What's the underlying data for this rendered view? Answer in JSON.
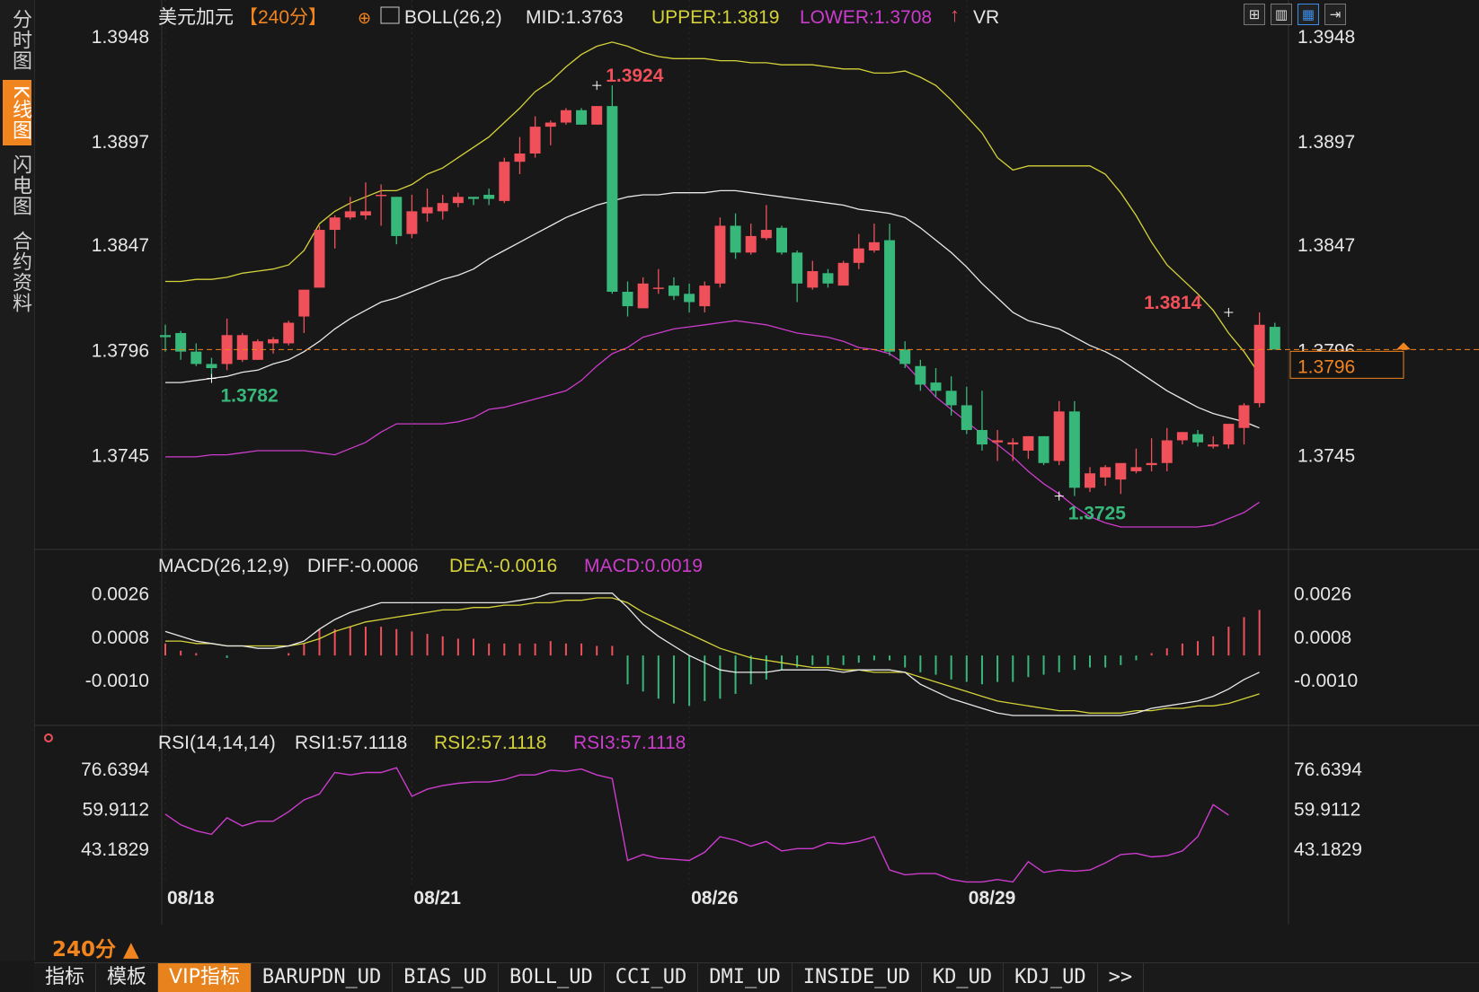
{
  "sidebar": {
    "tabs": [
      {
        "label": "分时图",
        "active": false
      },
      {
        "label": "K线图",
        "active": true
      },
      {
        "label": "闪电图",
        "active": false
      },
      {
        "label": "合约资料",
        "active": false
      }
    ]
  },
  "toolbar_icons": [
    "grid-icon",
    "bar-chart-icon",
    "candle-toggle-icon",
    "expand-icon"
  ],
  "period_label": "240分 ▲",
  "bottom_tabs": [
    {
      "label": "指标",
      "kind": "cn"
    },
    {
      "label": "模板",
      "kind": "cn"
    },
    {
      "label": "VIP指标",
      "kind": "vip"
    },
    {
      "label": "BARUPDN_UD",
      "kind": "mono"
    },
    {
      "label": "BIAS_UD",
      "kind": "mono"
    },
    {
      "label": "BOLL_UD",
      "kind": "mono"
    },
    {
      "label": "CCI_UD",
      "kind": "mono"
    },
    {
      "label": "DMI_UD",
      "kind": "mono"
    },
    {
      "label": "INSIDE_UD",
      "kind": "mono"
    },
    {
      "label": "KD_UD",
      "kind": "mono"
    },
    {
      "label": "KDJ_UD",
      "kind": "mono"
    },
    {
      "label": ">>",
      "kind": "mono"
    }
  ],
  "colors": {
    "up": "#f0505a",
    "down": "#38b77a",
    "mid": "#e8e8e8",
    "upper": "#d4d23a",
    "lower": "#cc3ccc",
    "dea": "#d4d23a",
    "macd": "#cc3ccc",
    "rsi": "#cc3ccc",
    "accent": "#f0841e",
    "grid": "#2a2a2a"
  },
  "chart_data": [
    {
      "type": "candlestick",
      "header": {
        "symbol": "美元加元",
        "period": "【240分】",
        "indicator": "BOLL(26,2)",
        "mid": "MID:1.3763",
        "upper": "UPPER:1.3819",
        "lower": "LOWER:1.3708",
        "extra": "VR"
      },
      "y_ticks": [
        "1.3948",
        "1.3897",
        "1.3847",
        "1.3796",
        "1.3745"
      ],
      "ylim": [
        1.37,
        1.3948
      ],
      "x_ticks": [
        "08/18",
        "08/21",
        "08/26",
        "08/29"
      ],
      "x_tick_index": [
        0,
        16,
        34,
        52
      ],
      "current_price": "1.3796",
      "annotations": [
        {
          "text": "1.3782",
          "index": 3,
          "value": 1.3782,
          "kind": "low"
        },
        {
          "text": "1.3924",
          "index": 28,
          "value": 1.3924,
          "kind": "high"
        },
        {
          "text": "1.3725",
          "index": 58,
          "value": 1.3725,
          "kind": "low"
        },
        {
          "text": "1.3814",
          "index": 69,
          "value": 1.3814,
          "kind": "high"
        }
      ],
      "ohlc": [
        [
          1.3803,
          1.3808,
          1.3795,
          1.3802
        ],
        [
          1.3804,
          1.3805,
          1.3791,
          1.3795
        ],
        [
          1.3795,
          1.3799,
          1.3788,
          1.3789
        ],
        [
          1.3789,
          1.3792,
          1.3782,
          1.3787
        ],
        [
          1.3789,
          1.3811,
          1.3786,
          1.3803
        ],
        [
          1.3791,
          1.3804,
          1.379,
          1.3803
        ],
        [
          1.3791,
          1.3801,
          1.3791,
          1.38
        ],
        [
          1.3799,
          1.3802,
          1.3794,
          1.3801
        ],
        [
          1.3799,
          1.381,
          1.3798,
          1.3809
        ],
        [
          1.3812,
          1.3821,
          1.3804,
          1.3825
        ],
        [
          1.3826,
          1.3856,
          1.3826,
          1.3854
        ],
        [
          1.3854,
          1.3861,
          1.3845,
          1.386
        ],
        [
          1.386,
          1.387,
          1.3859,
          1.3863
        ],
        [
          1.3861,
          1.3877,
          1.3859,
          1.3863
        ],
        [
          1.3871,
          1.3876,
          1.3856,
          1.3871
        ],
        [
          1.387,
          1.387,
          1.3847,
          1.3851
        ],
        [
          1.3852,
          1.3871,
          1.385,
          1.3863
        ],
        [
          1.3862,
          1.3874,
          1.3858,
          1.3865
        ],
        [
          1.3863,
          1.3871,
          1.3859,
          1.3867
        ],
        [
          1.3867,
          1.3872,
          1.3865,
          1.387
        ],
        [
          1.387,
          1.387,
          1.3866,
          1.3869
        ],
        [
          1.3871,
          1.3874,
          1.3866,
          1.3869
        ],
        [
          1.3868,
          1.3889,
          1.3867,
          1.3887
        ],
        [
          1.3887,
          1.3899,
          1.3881,
          1.3891
        ],
        [
          1.3891,
          1.3909,
          1.3889,
          1.3904
        ],
        [
          1.3904,
          1.3907,
          1.3895,
          1.3906
        ],
        [
          1.3906,
          1.3913,
          1.3905,
          1.3912
        ],
        [
          1.3912,
          1.3913,
          1.3905,
          1.3905
        ],
        [
          1.3905,
          1.3914,
          1.3905,
          1.3914
        ],
        [
          1.3914,
          1.3924,
          1.3823,
          1.3824
        ],
        [
          1.3824,
          1.3829,
          1.3812,
          1.3817
        ],
        [
          1.3816,
          1.3831,
          1.3816,
          1.3828
        ],
        [
          1.3826,
          1.3835,
          1.3823,
          1.3826
        ],
        [
          1.3827,
          1.3831,
          1.382,
          1.3822
        ],
        [
          1.3823,
          1.3828,
          1.3814,
          1.3819
        ],
        [
          1.3817,
          1.3829,
          1.3814,
          1.3827
        ],
        [
          1.3828,
          1.386,
          1.3826,
          1.3856
        ],
        [
          1.3856,
          1.3862,
          1.384,
          1.3843
        ],
        [
          1.3843,
          1.3857,
          1.3842,
          1.3851
        ],
        [
          1.385,
          1.3866,
          1.3849,
          1.3854
        ],
        [
          1.3855,
          1.3856,
          1.3842,
          1.3843
        ],
        [
          1.3843,
          1.3844,
          1.3819,
          1.3828
        ],
        [
          1.3826,
          1.3839,
          1.3825,
          1.3834
        ],
        [
          1.3833,
          1.3835,
          1.3826,
          1.3828
        ],
        [
          1.3827,
          1.3839,
          1.3827,
          1.3838
        ],
        [
          1.3838,
          1.3852,
          1.3835,
          1.3845
        ],
        [
          1.3844,
          1.3857,
          1.3843,
          1.3848
        ],
        [
          1.3849,
          1.3857,
          1.3793,
          1.3795
        ],
        [
          1.3796,
          1.38,
          1.3787,
          1.3789
        ],
        [
          1.3788,
          1.3791,
          1.3776,
          1.3779
        ],
        [
          1.378,
          1.3787,
          1.3773,
          1.3776
        ],
        [
          1.3776,
          1.3783,
          1.3764,
          1.3769
        ],
        [
          1.3769,
          1.3778,
          1.3755,
          1.3757
        ],
        [
          1.3757,
          1.3776,
          1.3747,
          1.375
        ],
        [
          1.3751,
          1.3757,
          1.3742,
          1.3752
        ],
        [
          1.375,
          1.3753,
          1.3742,
          1.3751
        ],
        [
          1.3747,
          1.3754,
          1.3743,
          1.3754
        ],
        [
          1.3754,
          1.3754,
          1.374,
          1.3741
        ],
        [
          1.3742,
          1.3771,
          1.374,
          1.3766
        ],
        [
          1.3766,
          1.3771,
          1.3725,
          1.3729
        ],
        [
          1.3729,
          1.3739,
          1.3727,
          1.3736
        ],
        [
          1.3734,
          1.374,
          1.373,
          1.3739
        ],
        [
          1.3733,
          1.3738,
          1.3726,
          1.3741
        ],
        [
          1.3737,
          1.3748,
          1.3736,
          1.3739
        ],
        [
          1.374,
          1.3753,
          1.3737,
          1.3741
        ],
        [
          1.3741,
          1.3758,
          1.3737,
          1.3752
        ],
        [
          1.3752,
          1.3756,
          1.375,
          1.3756
        ],
        [
          1.3755,
          1.3757,
          1.3749,
          1.3751
        ],
        [
          1.3749,
          1.3754,
          1.3748,
          1.375
        ],
        [
          1.375,
          1.3753,
          1.3748,
          1.376
        ],
        [
          1.3758,
          1.377,
          1.375,
          1.3769
        ],
        [
          1.377,
          1.3814,
          1.3768,
          1.3808
        ],
        [
          1.3807,
          1.3809,
          1.3796,
          1.3796
        ]
      ],
      "bands": {
        "upper": [
          1.3829,
          1.3829,
          1.383,
          1.383,
          1.3831,
          1.3833,
          1.3834,
          1.3835,
          1.3837,
          1.3844,
          1.3857,
          1.3863,
          1.3867,
          1.387,
          1.3873,
          1.3873,
          1.3876,
          1.3881,
          1.3884,
          1.3889,
          1.3894,
          1.3899,
          1.3906,
          1.3913,
          1.3921,
          1.3926,
          1.3933,
          1.3939,
          1.3943,
          1.3945,
          1.3943,
          1.394,
          1.3938,
          1.3937,
          1.3937,
          1.3937,
          1.3936,
          1.3936,
          1.3935,
          1.3935,
          1.3934,
          1.3934,
          1.3934,
          1.3933,
          1.3932,
          1.3932,
          1.393,
          1.393,
          1.3931,
          1.3928,
          1.3924,
          1.3917,
          1.3909,
          1.3901,
          1.3889,
          1.3883,
          1.3885,
          1.3885,
          1.3885,
          1.3885,
          1.3885,
          1.3881,
          1.3872,
          1.3861,
          1.3848,
          1.3837,
          1.383,
          1.3823,
          1.3815,
          1.3804,
          1.3795,
          1.3784
        ],
        "mid": [
          1.378,
          1.378,
          1.3781,
          1.3782,
          1.3783,
          1.3785,
          1.3786,
          1.3789,
          1.3791,
          1.3795,
          1.38,
          1.3806,
          1.3811,
          1.3815,
          1.3819,
          1.3821,
          1.3824,
          1.3827,
          1.383,
          1.3832,
          1.3835,
          1.384,
          1.3844,
          1.3848,
          1.3852,
          1.3856,
          1.386,
          1.3863,
          1.3866,
          1.3868,
          1.387,
          1.3871,
          1.3871,
          1.3872,
          1.3872,
          1.3872,
          1.3873,
          1.3873,
          1.3872,
          1.3871,
          1.387,
          1.3869,
          1.3868,
          1.3867,
          1.3866,
          1.3864,
          1.3863,
          1.3862,
          1.386,
          1.3855,
          1.3849,
          1.3843,
          1.3836,
          1.3828,
          1.3821,
          1.3814,
          1.381,
          1.3808,
          1.3806,
          1.3802,
          1.3798,
          1.3795,
          1.3791,
          1.3786,
          1.3781,
          1.3776,
          1.3772,
          1.3768,
          1.3765,
          1.3763,
          1.3761,
          1.3758
        ],
        "lower": [
          1.3744,
          1.3744,
          1.3744,
          1.3745,
          1.3745,
          1.3746,
          1.3747,
          1.3747,
          1.3747,
          1.3747,
          1.3746,
          1.3745,
          1.3748,
          1.3751,
          1.3756,
          1.376,
          1.376,
          1.376,
          1.376,
          1.3761,
          1.3763,
          1.3767,
          1.3768,
          1.377,
          1.3772,
          1.3774,
          1.3776,
          1.3781,
          1.3788,
          1.3794,
          1.3797,
          1.3802,
          1.3804,
          1.3806,
          1.3807,
          1.3808,
          1.3809,
          1.381,
          1.3809,
          1.3808,
          1.3806,
          1.3804,
          1.3803,
          1.3802,
          1.38,
          1.3797,
          1.3796,
          1.3794,
          1.3789,
          1.3781,
          1.3773,
          1.3767,
          1.3761,
          1.3755,
          1.375,
          1.3744,
          1.3737,
          1.3731,
          1.3726,
          1.372,
          1.3715,
          1.3712,
          1.371,
          1.371,
          1.371,
          1.371,
          1.371,
          1.371,
          1.3711,
          1.3714,
          1.3717,
          1.3722
        ]
      }
    },
    {
      "type": "bar_line",
      "header": {
        "name": "MACD(26,12,9)",
        "diff": "DIFF:-0.0006",
        "dea": "DEA:-0.0016",
        "macd": "MACD:0.0019"
      },
      "y_ticks": [
        "0.0026",
        "0.0008",
        "-0.0010"
      ],
      "ylim": [
        -0.0028,
        0.003
      ],
      "diff": [
        0.001,
        0.0008,
        0.0006,
        0.0005,
        0.0004,
        0.0004,
        0.0003,
        0.0003,
        0.0004,
        0.0006,
        0.0011,
        0.0015,
        0.0018,
        0.002,
        0.0022,
        0.0022,
        0.0022,
        0.0022,
        0.0022,
        0.0022,
        0.0022,
        0.0022,
        0.0022,
        0.0023,
        0.0024,
        0.0026,
        0.0026,
        0.0026,
        0.0026,
        0.0026,
        0.002,
        0.0013,
        0.0008,
        0.0004,
        0.0,
        -0.0003,
        -0.0006,
        -0.0007,
        -0.0007,
        -0.0007,
        -0.0006,
        -0.0006,
        -0.0006,
        -0.0006,
        -0.0007,
        -0.0006,
        -0.0006,
        -0.0006,
        -0.0007,
        -0.0012,
        -0.0015,
        -0.0018,
        -0.002,
        -0.0022,
        -0.0024,
        -0.0025,
        -0.0025,
        -0.0025,
        -0.0025,
        -0.0025,
        -0.0025,
        -0.0025,
        -0.0025,
        -0.0024,
        -0.0022,
        -0.0021,
        -0.002,
        -0.0019,
        -0.0017,
        -0.0014,
        -0.001,
        -0.0007
      ],
      "dea": [
        0.0006,
        0.0006,
        0.0005,
        0.0005,
        0.0004,
        0.0004,
        0.0004,
        0.0004,
        0.0004,
        0.0005,
        0.0007,
        0.001,
        0.0012,
        0.0014,
        0.0015,
        0.0016,
        0.0017,
        0.0018,
        0.0019,
        0.0019,
        0.002,
        0.002,
        0.0021,
        0.0021,
        0.0022,
        0.0022,
        0.0023,
        0.0023,
        0.0024,
        0.0024,
        0.0022,
        0.0018,
        0.0015,
        0.0012,
        0.0009,
        0.0006,
        0.0003,
        0.0001,
        -0.0001,
        -0.0002,
        -0.0003,
        -0.0004,
        -0.0005,
        -0.0005,
        -0.0006,
        -0.0006,
        -0.0007,
        -0.0007,
        -0.0007,
        -0.0009,
        -0.0011,
        -0.0013,
        -0.0015,
        -0.0017,
        -0.0019,
        -0.002,
        -0.0021,
        -0.0022,
        -0.0023,
        -0.0023,
        -0.0024,
        -0.0024,
        -0.0024,
        -0.0023,
        -0.0023,
        -0.0022,
        -0.0022,
        -0.0021,
        -0.0021,
        -0.002,
        -0.0018,
        -0.0016
      ],
      "macd": [
        0.0005,
        0.0002,
        0.0001,
        0.0,
        -0.0001,
        0.0,
        0.0,
        0.0,
        0.0001,
        0.0005,
        0.0011,
        0.0011,
        0.0012,
        0.0012,
        0.0012,
        0.0011,
        0.001,
        0.0009,
        0.0008,
        0.0007,
        0.0007,
        0.0005,
        0.0005,
        0.0005,
        0.0005,
        0.0006,
        0.0005,
        0.0005,
        0.0004,
        0.0004,
        -0.0012,
        -0.0015,
        -0.0018,
        -0.002,
        -0.0021,
        -0.0019,
        -0.0018,
        -0.0016,
        -0.0012,
        -0.001,
        -0.0006,
        -0.0005,
        -0.0004,
        -0.0004,
        -0.0004,
        -0.0003,
        -0.0002,
        -0.0002,
        -0.0005,
        -0.0007,
        -0.0008,
        -0.001,
        -0.0011,
        -0.0012,
        -0.0011,
        -0.0011,
        -0.0009,
        -0.0008,
        -0.0007,
        -0.0006,
        -0.0005,
        -0.0005,
        -0.0004,
        -0.0002,
        0.0001,
        0.0003,
        0.0005,
        0.0006,
        0.0008,
        0.0012,
        0.0016,
        0.0019
      ]
    },
    {
      "type": "line",
      "header": {
        "name": "RSI(14,14,14)",
        "rsi1": "RSI1:57.1118",
        "rsi2": "RSI2:57.1118",
        "rsi3": "RSI3:57.1118"
      },
      "y_ticks": [
        "76.6394",
        "59.9112",
        "43.1829"
      ],
      "ylim": [
        28,
        82
      ],
      "values": [
        57.5,
        53.0,
        50.5,
        49.0,
        56.0,
        52.5,
        54.5,
        54.5,
        58.5,
        63.5,
        66.0,
        75.0,
        74.0,
        75.0,
        75.0,
        77.0,
        65.0,
        68.0,
        69.5,
        70.5,
        71.0,
        71.0,
        72.0,
        74.0,
        74.0,
        76.0,
        75.5,
        76.5,
        74.0,
        72.5,
        38.0,
        40.5,
        39.0,
        38.5,
        38.0,
        41.5,
        48.0,
        46.5,
        44.0,
        46.0,
        42.0,
        43.0,
        43.0,
        45.5,
        45.0,
        46.0,
        48.0,
        34.0,
        32.0,
        32.5,
        32.5,
        30.0,
        29.0,
        29.0,
        30.0,
        29.0,
        37.5,
        33.0,
        34.0,
        33.5,
        34.0,
        37.0,
        40.5,
        41.0,
        39.5,
        40.0,
        42.0,
        48.0,
        61.5,
        57.1
      ]
    }
  ]
}
